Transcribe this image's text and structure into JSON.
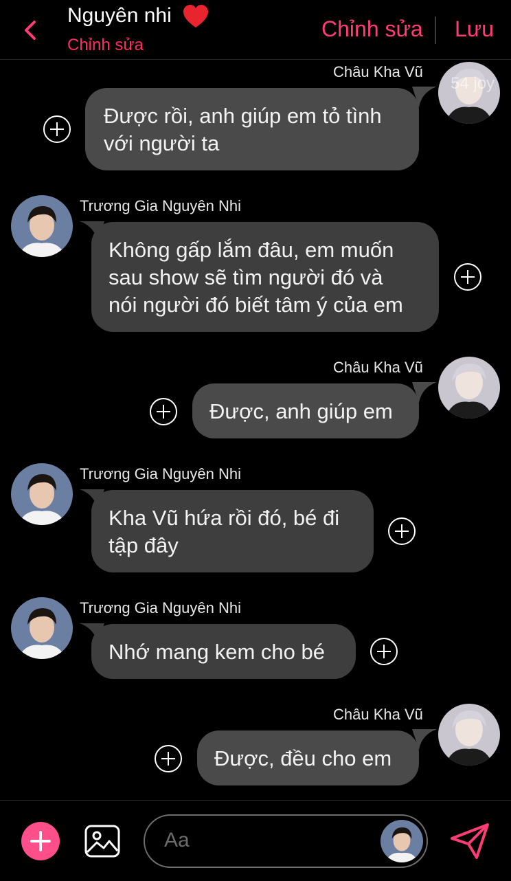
{
  "header": {
    "title": "Nguyên nhi",
    "subtitle": "Chỉnh sửa",
    "edit_label": "Chỉnh sửa",
    "save_label": "Lưu"
  },
  "accent_color": "#ff3c74",
  "messages": [
    {
      "sender": "Châu Kha Vũ",
      "side": "right",
      "lines": [
        "Được rồi, anh giúp em tỏ tình",
        "với người ta"
      ]
    },
    {
      "sender": "Trương Gia Nguyên Nhi",
      "side": "left",
      "lines": [
        "Không gấp lắm đâu, em muốn",
        "sau show sẽ tìm người đó và",
        "nói người đó biết tâm ý của em"
      ]
    },
    {
      "sender": "Châu Kha Vũ",
      "side": "right",
      "lines": [
        "Được, anh giúp em"
      ]
    },
    {
      "sender": "Trương Gia Nguyên Nhi",
      "side": "left",
      "lines": [
        "Kha Vũ hứa rồi đó, bé đi",
        "tập đây"
      ]
    },
    {
      "sender": "Trương Gia Nguyên Nhi",
      "side": "left",
      "lines": [
        "Nhớ mang kem cho bé"
      ]
    },
    {
      "sender": "Châu Kha Vũ",
      "side": "right",
      "lines": [
        "Được, đều cho em"
      ]
    }
  ],
  "watermark": "54 joy",
  "composer": {
    "placeholder": "Aa"
  }
}
